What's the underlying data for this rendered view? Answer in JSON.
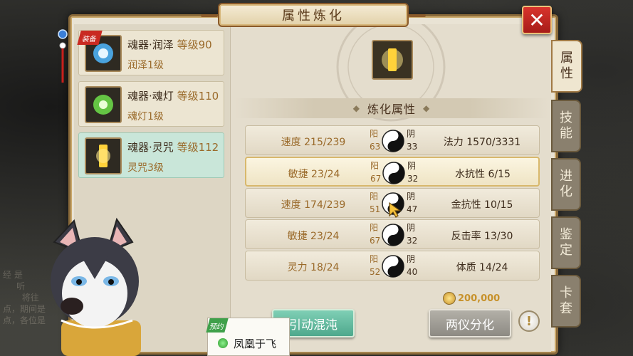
{
  "window": {
    "title": "属性炼化",
    "close_label": "✕"
  },
  "side_tabs": [
    {
      "label": "属\n性",
      "active": true
    },
    {
      "label": "技\n能",
      "active": false
    },
    {
      "label": "进\n化",
      "active": false
    },
    {
      "label": "鉴\n定",
      "active": false
    },
    {
      "label": "卡\n套",
      "active": false
    }
  ],
  "items": [
    {
      "name": "魂器·润泽",
      "level": "等级90",
      "sub": "润泽1级",
      "badge": "装备",
      "selected": false,
      "glow": "#4fb8ff"
    },
    {
      "name": "魂器·魂灯",
      "level": "等级110",
      "sub": "魂灯1级",
      "badge": "",
      "selected": false,
      "glow": "#6fe04a"
    },
    {
      "name": "魂器·灵咒",
      "level": "等级112",
      "sub": "灵咒3级",
      "badge": "",
      "selected": true,
      "glow": "#ffd23a"
    }
  ],
  "section_title": "炼化属性",
  "yang_label": "阳",
  "yin_label": "阴",
  "attr_rows": [
    {
      "left": "速度 215/239",
      "yang": "63",
      "yin": "33",
      "right": "法力 1570/3331",
      "highlight": false
    },
    {
      "left": "敏捷 23/24",
      "yang": "67",
      "yin": "32",
      "right": "水抗性 6/15",
      "highlight": true
    },
    {
      "left": "速度 174/239",
      "yang": "51",
      "yin": "47",
      "right": "金抗性 10/15",
      "highlight": false
    },
    {
      "left": "敏捷 23/24",
      "yang": "67",
      "yin": "32",
      "right": "反击率 13/30",
      "highlight": false
    },
    {
      "left": "灵力 18/24",
      "yang": "52",
      "yin": "40",
      "right": "体质 14/24",
      "highlight": false
    }
  ],
  "cost": "200,000",
  "buttons": {
    "left": "引动混沌",
    "right": "两仪分化",
    "info": "!"
  },
  "chat": {
    "tag": "预约",
    "message": "凤凰于飞"
  },
  "colors": {
    "accent_gold": "#9a6a2a",
    "close_red": "#c92a22",
    "green_button": "#5fb89c",
    "gray_button": "#9d9a93"
  }
}
